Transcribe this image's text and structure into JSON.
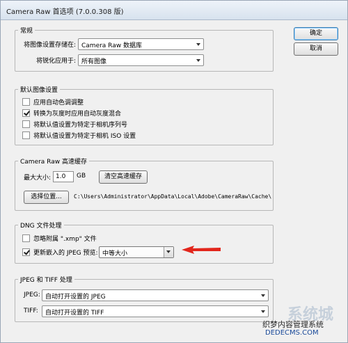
{
  "window": {
    "title": "Camera Raw 首选项  (7.0.0.308 版)"
  },
  "buttons": {
    "ok": "确定",
    "cancel": "取消"
  },
  "general": {
    "title": "常规",
    "save_label": "将图像设置存储在:",
    "save_value": "Camera Raw 数据库",
    "sharpen_label": "将锐化应用于:",
    "sharpen_value": "所有图像"
  },
  "defaults": {
    "title": "默认图像设置",
    "items": [
      {
        "label": "应用自动色调调整",
        "checked": false
      },
      {
        "label": "转换为灰度时应用自动灰度混合",
        "checked": true
      },
      {
        "label": "将默认值设置为特定于相机序列号",
        "checked": false
      },
      {
        "label": "将默认值设置为特定于相机 ISO 设置",
        "checked": false
      }
    ]
  },
  "cache": {
    "title": "Camera Raw 高速缓存",
    "max_label": "最大大小:",
    "max_value": "1.0",
    "unit": "GB",
    "purge_button": "清空高速缓存",
    "select_button": "选择位置...",
    "path": "C:\\Users\\Administrator\\AppData\\Local\\Adobe\\CameraRaw\\Cache\\"
  },
  "dng": {
    "title": "DNG 文件处理",
    "ignore_label": "忽略附属 \".xmp\" 文件",
    "ignore_checked": false,
    "update_label": "更新嵌入的 JPEG 预览:",
    "update_checked": true,
    "preview_value": "中等大小"
  },
  "jpeg_tiff": {
    "title": "JPEG 和 TIFF 处理",
    "jpeg_label": "JPEG:",
    "jpeg_value": "自动打开设置的 JPEG",
    "tiff_label": "TIFF:",
    "tiff_value": "自动打开设置的 TIFF"
  },
  "annotation": {
    "arrow_color": "#e2261c"
  },
  "watermark": {
    "big": "系统城",
    "line1": "织梦内容管理系统",
    "line2": "DEDECMS.COM"
  }
}
